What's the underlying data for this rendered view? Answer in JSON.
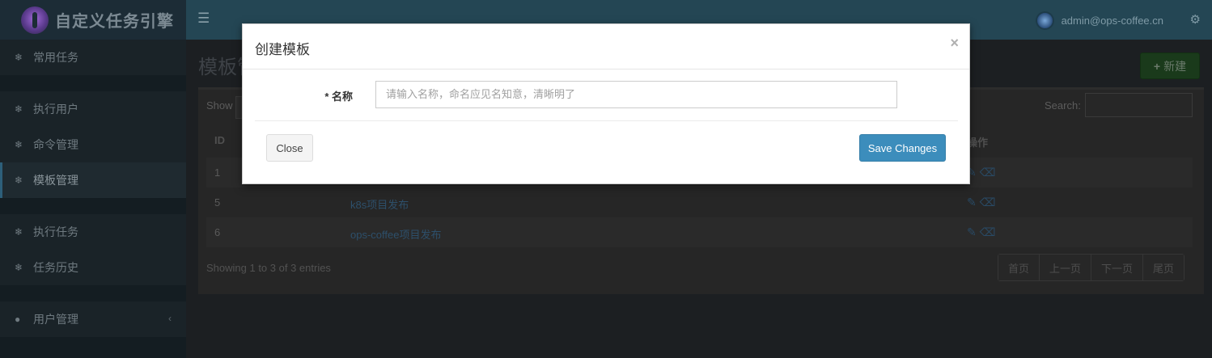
{
  "app": {
    "title": "自定义任务引擎"
  },
  "topbar": {
    "user": "admin@ops-coffee.cn",
    "toggle_icon": "menu-icon",
    "settings_icon": "gears-icon"
  },
  "sidebar": {
    "items": [
      {
        "label": "常用任务",
        "icon": "paw-icon"
      },
      {
        "label": "执行用户",
        "icon": "paw-icon"
      },
      {
        "label": "命令管理",
        "icon": "paw-icon"
      },
      {
        "label": "模板管理",
        "icon": "paw-icon",
        "active": true
      },
      {
        "label": "执行任务",
        "icon": "paw-icon"
      },
      {
        "label": "任务历史",
        "icon": "paw-icon"
      },
      {
        "label": "用户管理",
        "icon": "users-icon"
      }
    ]
  },
  "main": {
    "title": "模板管",
    "new_button": "新建",
    "show_label": "Show",
    "search_label": "Search:",
    "columns": [
      "ID",
      "操作"
    ],
    "rows": [
      {
        "id": "1",
        "name": ""
      },
      {
        "id": "5",
        "name": "k8s项目发布"
      },
      {
        "id": "6",
        "name": "ops-coffee项目发布"
      }
    ],
    "info": "Showing 1 to 3 of 3 entries",
    "pager": [
      "首页",
      "上一页",
      "下一页",
      "尾页"
    ]
  },
  "modal": {
    "title": "创建模板",
    "close_x": "×",
    "name_label": "* 名称",
    "name_placeholder": "请输入名称，命名应见名知意，清晰明了",
    "name_value": "",
    "close_button": "Close",
    "save_button": "Save Changes"
  },
  "colors": {
    "primary": "#3c8dbc",
    "header": "#244654",
    "sidebar": "#141d22"
  }
}
